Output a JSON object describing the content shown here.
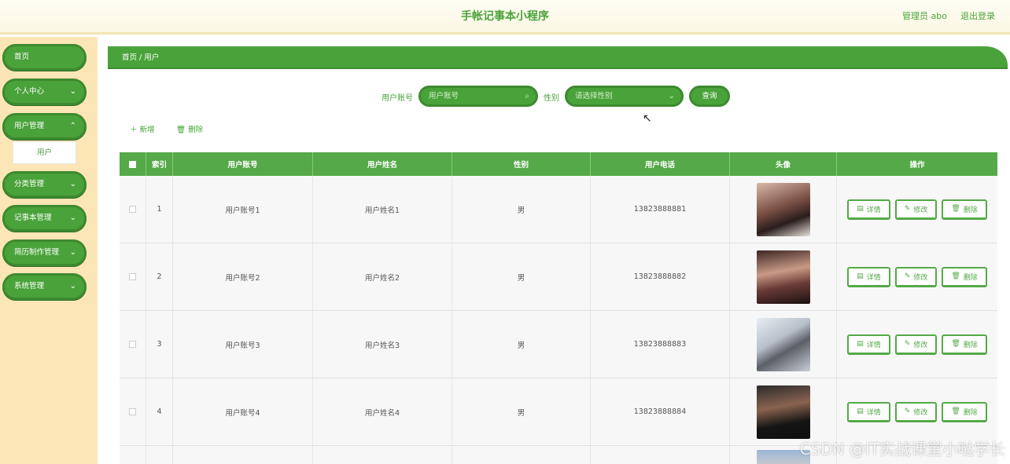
{
  "header": {
    "title": "手帐记事本小程序",
    "admin": "管理员 abo",
    "logout": "退出登录"
  },
  "sidebar": {
    "items": [
      {
        "label": "首页",
        "chevron": ""
      },
      {
        "label": "个人中心",
        "chevron": "⌄"
      },
      {
        "label": "用户管理",
        "chevron": "⌃"
      },
      {
        "label": "分类管理",
        "chevron": "⌄"
      },
      {
        "label": "记事本管理",
        "chevron": "⌄"
      },
      {
        "label": "简历制作管理",
        "chevron": "⌄"
      },
      {
        "label": "系统管理",
        "chevron": "⌄"
      }
    ],
    "sub_item": "用户"
  },
  "breadcrumb": "首页 / 用户",
  "search": {
    "account_label": "用户账号",
    "account_placeholder": "用户账号",
    "gender_label": "性别",
    "gender_placeholder": "请选择性别",
    "query_button": "查询"
  },
  "toolbar": {
    "add": "新增",
    "delete": "删除"
  },
  "table": {
    "headers": [
      "索引",
      "用户账号",
      "用户姓名",
      "性别",
      "用户电话",
      "头像",
      "操作"
    ],
    "rows": [
      {
        "index": "1",
        "account": "用户账号1",
        "name": "用户姓名1",
        "gender": "男",
        "phone": "13823888881"
      },
      {
        "index": "2",
        "account": "用户账号2",
        "name": "用户姓名2",
        "gender": "男",
        "phone": "13823888882"
      },
      {
        "index": "3",
        "account": "用户账号3",
        "name": "用户姓名3",
        "gender": "男",
        "phone": "13823888883"
      },
      {
        "index": "4",
        "account": "用户账号4",
        "name": "用户姓名4",
        "gender": "男",
        "phone": "13823888884"
      }
    ],
    "actions": {
      "detail": "详情",
      "edit": "修改",
      "delete": "删除"
    }
  },
  "watermark": "CSDN @IT实战课堂小哒学长",
  "colors": {
    "accent": "#4aa33a",
    "sidebar_bg": "#fde6b5"
  }
}
